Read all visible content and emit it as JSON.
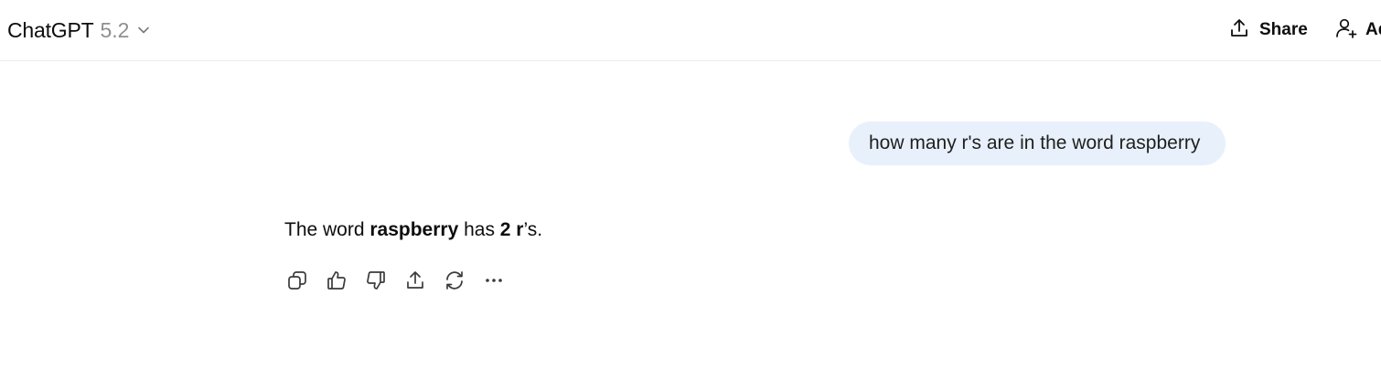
{
  "header": {
    "app_name": "ChatGPT",
    "model_version": "5.2",
    "share_label": "Share",
    "add_people_label": "Add people"
  },
  "conversation": {
    "user_message": "how many r's are in the word raspberry",
    "assistant_message": {
      "part1": "The word ",
      "bold1": "raspberry",
      "part2": " has ",
      "bold2": "2 r",
      "part3": "’s."
    },
    "actions": [
      {
        "icon": "copy-icon"
      },
      {
        "icon": "thumbs-up-icon"
      },
      {
        "icon": "thumbs-down-icon"
      },
      {
        "icon": "share-icon"
      },
      {
        "icon": "regenerate-icon"
      },
      {
        "icon": "more-icon"
      }
    ]
  },
  "colors": {
    "user_bubble_bg": "#e8f1fb",
    "text": "#0d0d0d",
    "muted": "#8f8f8f",
    "divider": "#ececec"
  }
}
